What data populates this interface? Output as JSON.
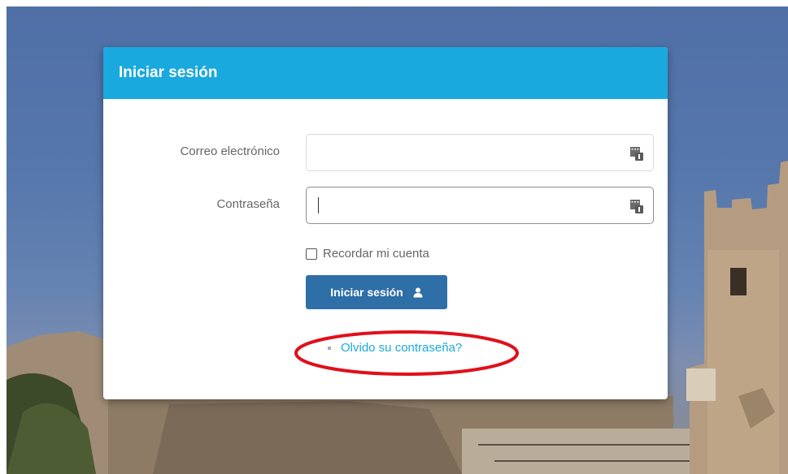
{
  "modal": {
    "title": "Iniciar sesión"
  },
  "form": {
    "email_label": "Correo electrónico",
    "email_value": "",
    "password_label": "Contraseña",
    "password_value": "",
    "remember_label": "Recordar mi cuenta",
    "remember_checked": false,
    "submit_label": "Iniciar sesión",
    "forgot_label": "Olvido su contraseña?"
  },
  "icons": {
    "field_icon": "keyboard-icon",
    "submit_icon": "user-icon",
    "annotation": "red-ellipse-highlight"
  },
  "colors": {
    "header": "#1aa9de",
    "button": "#2f6fa8",
    "link": "#1aa9de",
    "annotation": "#e0101a"
  }
}
